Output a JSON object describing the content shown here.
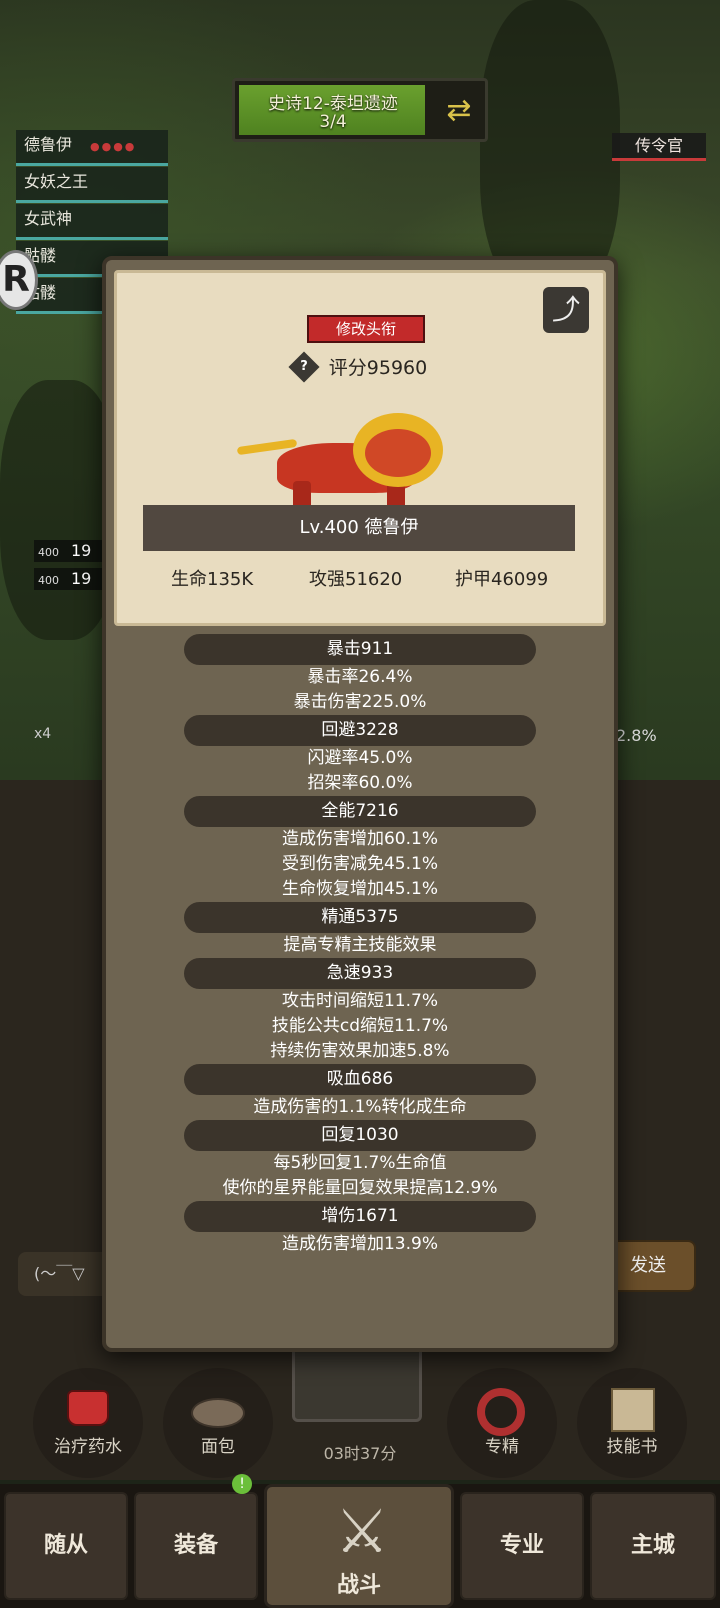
{
  "quest": {
    "title": "史诗12-泰坦遗迹",
    "progress": "3/4",
    "progress_fraction": 0.75
  },
  "roster": [
    {
      "name": "德鲁伊",
      "stars": "●●●●"
    },
    {
      "name": "女妖之王",
      "stars": ""
    },
    {
      "name": "女武神",
      "stars": ""
    },
    {
      "name": "骷髅",
      "stars": ""
    },
    {
      "name": "骷髅",
      "stars": ""
    }
  ],
  "herald_label": "传令官",
  "side": {
    "hp1_level": "400",
    "hp1_value": "19",
    "hp2_level": "400",
    "hp2_value": "19",
    "x4": "x4",
    "pct": "2.8%",
    "chat_hint": "(～￣▽",
    "send_label": "发送"
  },
  "dialog": {
    "edit_title_label": "修改头衔",
    "score": "评分95960",
    "name_plate": "Lv.400 德鲁伊",
    "stats": {
      "hp": "生命135K",
      "attack": "攻强51620",
      "armor": "护甲46099"
    },
    "groups": [
      {
        "header": "暴击911",
        "lines": [
          "暴击率26.4%",
          "暴击伤害225.0%"
        ]
      },
      {
        "header": "回避3228",
        "lines": [
          "闪避率45.0%",
          "招架率60.0%"
        ]
      },
      {
        "header": "全能7216",
        "lines": [
          "造成伤害增加60.1%",
          "受到伤害减免45.1%",
          "生命恢复增加45.1%"
        ]
      },
      {
        "header": "精通5375",
        "lines": [
          "提高专精主技能效果"
        ]
      },
      {
        "header": "急速933",
        "lines": [
          "攻击时间缩短11.7%",
          "技能公共cd缩短11.7%",
          "持续伤害效果加速5.8%"
        ]
      },
      {
        "header": "吸血686",
        "lines": [
          "造成伤害的1.1%转化成生命"
        ]
      },
      {
        "header": "回复1030",
        "lines": [
          "每5秒回复1.7%生命值",
          "使你的星界能量回复效果提高12.9%"
        ]
      },
      {
        "header": "增伤1671",
        "lines": [
          "造成伤害增加13.9%"
        ]
      }
    ]
  },
  "actions": [
    {
      "label": "治疗药水",
      "icon": "potion-icon"
    },
    {
      "label": "面包",
      "icon": "bread-icon"
    },
    {
      "label": "专精",
      "icon": "spec-icon"
    },
    {
      "label": "技能书",
      "icon": "book-icon"
    }
  ],
  "timer": "03时37分",
  "nav": {
    "follower": "随从",
    "equipment": "装备",
    "battle": "战斗",
    "profession": "专业",
    "city": "主城",
    "equipment_badge": "!"
  }
}
